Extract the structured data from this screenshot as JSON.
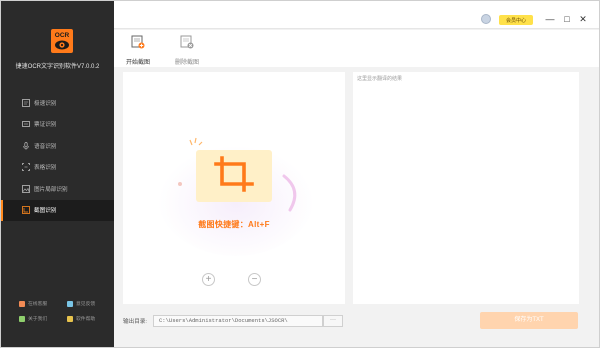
{
  "app": {
    "title": "捷速OCR文字识别软件V7.0.0.2",
    "logo_text": "OCR",
    "accent": "#ff8a1f"
  },
  "sidebar": {
    "items": [
      {
        "label": "极速识别",
        "icon": "screen-icon",
        "active": false
      },
      {
        "label": "票证识别",
        "icon": "ticket-icon",
        "active": false
      },
      {
        "label": "语音识别",
        "icon": "voice-icon",
        "active": false
      },
      {
        "label": "表格识别",
        "icon": "table-icon",
        "active": false
      },
      {
        "label": "图片局部识别",
        "icon": "image-crop-icon",
        "active": false
      },
      {
        "label": "截图识别",
        "icon": "screenshot-icon",
        "active": true
      }
    ],
    "footer": [
      {
        "label": "在线客服",
        "icon": "service-icon",
        "color": "#f28b55"
      },
      {
        "label": "意见反馈",
        "icon": "feedback-icon",
        "color": "#7ac5e6"
      },
      {
        "label": "关于我们",
        "icon": "about-icon",
        "color": "#8fcf6d"
      },
      {
        "label": "软件帮助",
        "icon": "help-icon",
        "color": "#e7c34d"
      }
    ]
  },
  "titlebar": {
    "member_label": "会员中心",
    "minimize": "—",
    "maximize": "□",
    "close": "✕"
  },
  "toolbar": {
    "start_label": "开始截图",
    "delete_label": "删除截图"
  },
  "main": {
    "shortcut_text": "截图快捷键：Alt+F",
    "zoom_in": "+",
    "zoom_out": "−",
    "result_hint": "这里显示翻译的结果"
  },
  "bottom": {
    "output_label": "输出目录:",
    "output_path": "C:\\Users\\Administrator\\Documents\\JSOCR\\",
    "browse_label": "···",
    "save_label": "保存为TXT"
  }
}
